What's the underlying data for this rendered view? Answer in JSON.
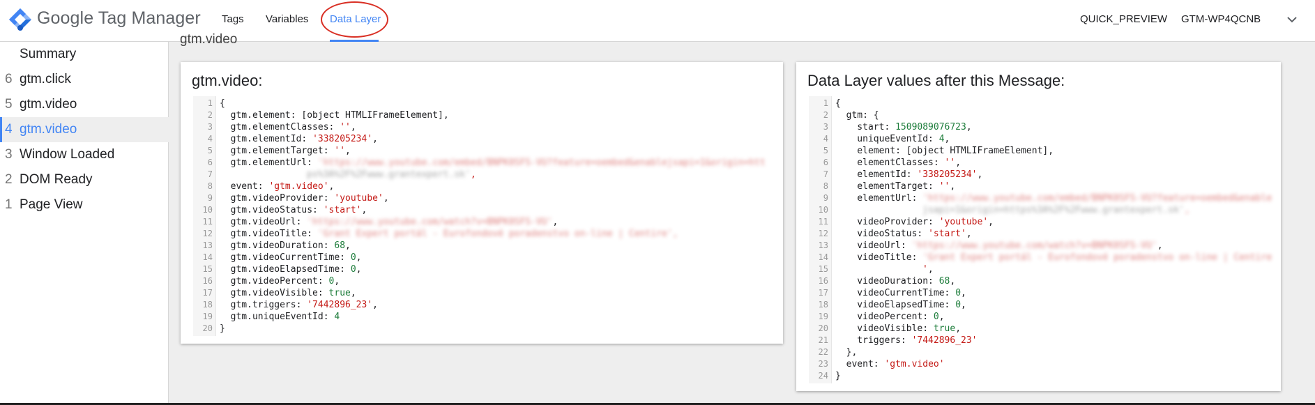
{
  "header": {
    "brand": "Google Tag Manager",
    "tabs": [
      {
        "label": "Tags"
      },
      {
        "label": "Variables"
      },
      {
        "label": "Data Layer"
      }
    ],
    "quick_preview": "QUICK_PREVIEW",
    "container_id": "GTM-WP4QCNB"
  },
  "sidebar": {
    "items": [
      {
        "num": "",
        "label": "Summary"
      },
      {
        "num": "6",
        "label": "gtm.click"
      },
      {
        "num": "5",
        "label": "gtm.video"
      },
      {
        "num": "4",
        "label": "gtm.video"
      },
      {
        "num": "3",
        "label": "Window Loaded"
      },
      {
        "num": "2",
        "label": "DOM Ready"
      },
      {
        "num": "1",
        "label": "Page View"
      }
    ]
  },
  "main": {
    "cut_title": "gtm.video",
    "left_card": {
      "title": "gtm.video:",
      "line_numbers": [
        "1",
        "2",
        "3",
        "4",
        "5",
        "6",
        "7",
        "8",
        "9",
        "10",
        "11",
        "12",
        "13",
        "14",
        "15",
        "16",
        "17",
        "18",
        "19",
        "20"
      ],
      "lines": {
        "l1": "{",
        "l2": "  gtm.element: [object HTMLIFrameElement],",
        "l3k": "  gtm.elementClasses: ",
        "l3v": "''",
        "l3e": ",",
        "l4k": "  gtm.elementId: ",
        "l4v": "'338205234'",
        "l4e": ",",
        "l5k": "  gtm.elementTarget: ",
        "l5v": "''",
        "l5e": ",",
        "l6k": "  gtm.elementUrl: ",
        "l6v": "'https://www.youtube.com/embed/BNPK0SFS-VU?feature=oembed&enablejsapi=1&origin=htt",
        "l7v": "ps%3A%2F%2Fwww.grantexpert.sk'",
        "l7e": ",",
        "l8k": "  event: ",
        "l8v": "'gtm.video'",
        "l8e": ",",
        "l9k": "  gtm.videoProvider: ",
        "l9v": "'youtube'",
        "l9e": ",",
        "l10k": "  gtm.videoStatus: ",
        "l10v": "'start'",
        "l10e": ",",
        "l11k": "  gtm.videoUrl: ",
        "l11v": "'https://www.youtube.com/watch?v=BNPK0SFS-VU'",
        "l11e": ",",
        "l12k": "  gtm.videoTitle: ",
        "l12v": "'Grant Expert portál - Eurofondové poradenstvo on-line | Centire'",
        "l12e": ",",
        "l13k": "  gtm.videoDuration: ",
        "l13v": "68",
        "l13e": ",",
        "l14k": "  gtm.videoCurrentTime: ",
        "l14v": "0",
        "l14e": ",",
        "l15k": "  gtm.videoElapsedTime: ",
        "l15v": "0",
        "l15e": ",",
        "l16k": "  gtm.videoPercent: ",
        "l16v": "0",
        "l16e": ",",
        "l17k": "  gtm.videoVisible: ",
        "l17v": "true",
        "l17e": ",",
        "l18k": "  gtm.triggers: ",
        "l18v": "'7442896_23'",
        "l18e": ",",
        "l19k": "  gtm.uniqueEventId: ",
        "l19v": "4",
        "l20": "}"
      }
    },
    "right_card": {
      "title": "Data Layer values after this Message:",
      "line_numbers": [
        "1",
        "2",
        "3",
        "4",
        "5",
        "6",
        "7",
        "8",
        "9",
        "10",
        "11",
        "12",
        "13",
        "14",
        "15",
        "16",
        "17",
        "18",
        "19",
        "20",
        "21",
        "22",
        "23",
        "24"
      ],
      "lines": {
        "r1": "{",
        "r2": "  gtm: {",
        "r3k": "    start: ",
        "r3v": "1509089076723",
        "r3e": ",",
        "r4k": "    uniqueEventId: ",
        "r4v": "4",
        "r4e": ",",
        "r5": "    element: [object HTMLIFrameElement],",
        "r6k": "    elementClasses: ",
        "r6v": "''",
        "r6e": ",",
        "r7k": "    elementId: ",
        "r7v": "'338205234'",
        "r7e": ",",
        "r8k": "    elementTarget: ",
        "r8v": "''",
        "r8e": ",",
        "r9k": "    elementUrl: ",
        "r9v": "'https://www.youtube.com/embed/BNPK0SFS-VU?feature=oembed&enable",
        "r10v": "jsapi=1&origin=https%3A%2F%2Fwww.grantexpert.sk'",
        "r10e": ",",
        "r11k": "    videoProvider: ",
        "r11v": "'youtube'",
        "r11e": ",",
        "r12k": "    videoStatus: ",
        "r12v": "'start'",
        "r12e": ",",
        "r13k": "    videoUrl: ",
        "r13v": "'https://www.youtube.com/watch?v=BNPK0SFS-VU'",
        "r13e": ",",
        "r14k": "    videoTitle: ",
        "r14v": "'Grant Expert portál - Eurofondové poradenstvo on-line | Centire",
        "r15v": "'",
        "r15e": ",",
        "r16k": "    videoDuration: ",
        "r16v": "68",
        "r16e": ",",
        "r17k": "    videoCurrentTime: ",
        "r17v": "0",
        "r17e": ",",
        "r18k": "    videoElapsedTime: ",
        "r18v": "0",
        "r18e": ",",
        "r19k": "    videoPercent: ",
        "r19v": "0",
        "r19e": ",",
        "r20k": "    videoVisible: ",
        "r20v": "true",
        "r20e": ",",
        "r21k": "    triggers: ",
        "r21v": "'7442896_23'",
        "r22": "  },",
        "r23k": "  event: ",
        "r23v": "'gtm.video'",
        "r24": "}"
      }
    }
  },
  "colors": {
    "accent": "#4285f4",
    "annotation_circle": "#d93025",
    "string": "#c41a16",
    "number": "#1c7c3a"
  },
  "icons": {
    "logo": "gtm-diamond-logo",
    "chevron": "chevron-down-icon"
  }
}
